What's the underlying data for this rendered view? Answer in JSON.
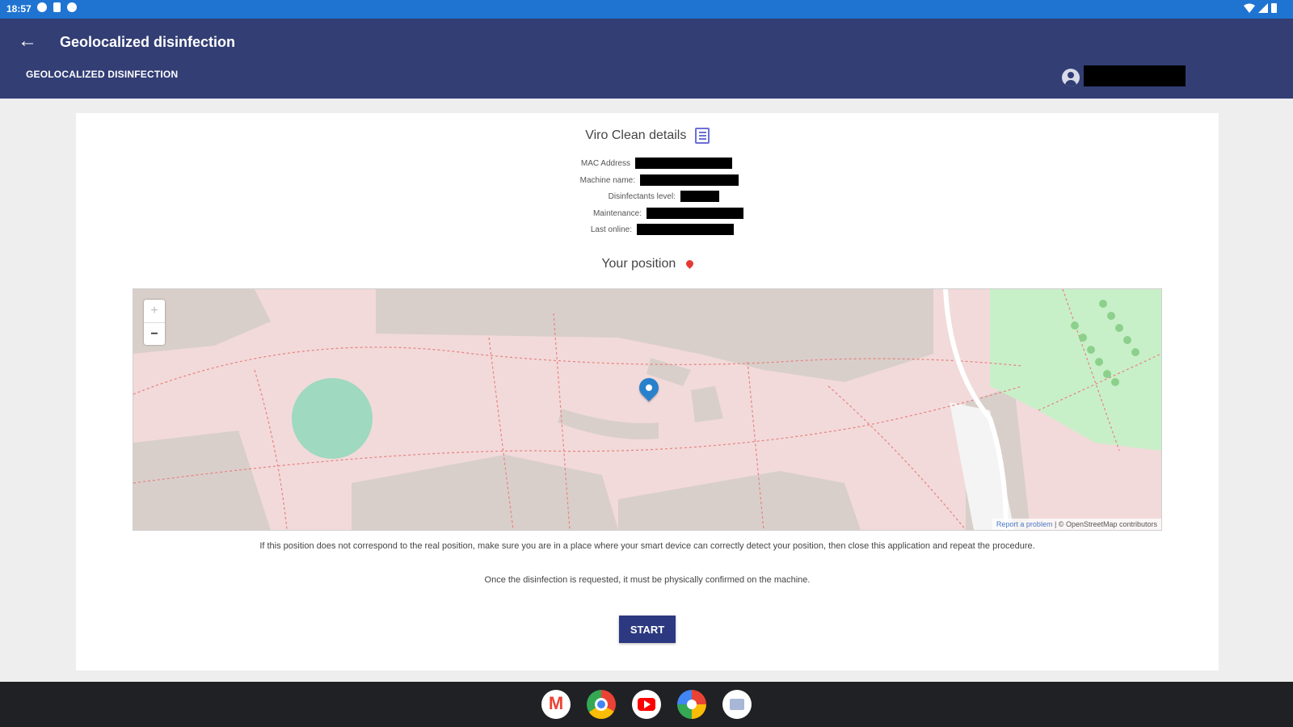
{
  "status_bar": {
    "time": "18:57"
  },
  "app_bar": {
    "title": "Geolocalized disinfection",
    "subtitle": "GEOLOCALIZED DISINFECTION"
  },
  "details": {
    "title": "Viro Clean details",
    "rows": [
      {
        "label": "MAC Address"
      },
      {
        "label": "Machine name:"
      },
      {
        "label": "Disinfectants level:"
      },
      {
        "label": "Maintenance:"
      },
      {
        "label": "Last online:"
      }
    ]
  },
  "position": {
    "title": "Your position"
  },
  "map": {
    "zoom_in": "+",
    "zoom_out": "−",
    "attribution_link": "Report a problem",
    "attribution_text": "| © OpenStreetMap contributors"
  },
  "notices": {
    "line1": "If this position does not correspond to the real position, make sure you are in a place where your smart device can correctly detect your position, then close this application and repeat the procedure.",
    "line2": "Once the disinfection is requested, it must be physically confirmed on the machine."
  },
  "actions": {
    "start_label": "START"
  },
  "colors": {
    "status_bar": "#1f74d2",
    "app_bar": "#323e74",
    "start_button": "#2c3980",
    "map_base": "#f2dada",
    "park": "#c8f0c8",
    "building": "#d9cfca",
    "marker": "#2a81cb",
    "position_pin": "#e53935"
  },
  "taskbar": {
    "apps": [
      "gmail-icon",
      "chrome-icon",
      "youtube-icon",
      "photos-icon",
      "messages-icon"
    ]
  }
}
